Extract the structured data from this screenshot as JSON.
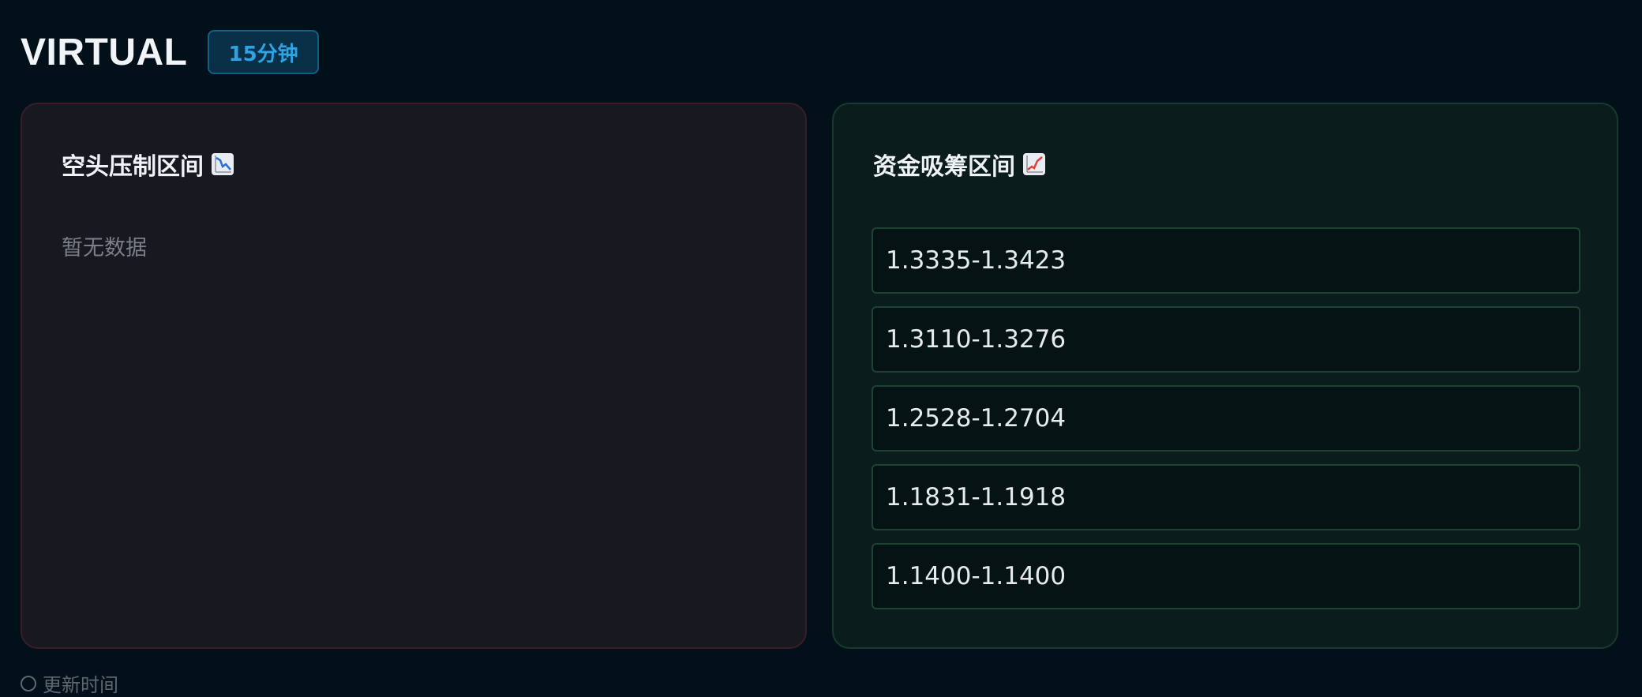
{
  "header": {
    "symbol": "VIRTUAL",
    "timeframe": "15分钟"
  },
  "panels": {
    "resistance": {
      "title": "空头压制区间",
      "icon": "chart-decreasing-icon",
      "empty_text": "暂无数据"
    },
    "support": {
      "title": "资金吸筹区间",
      "icon": "chart-increasing-icon",
      "zones": [
        "1.3335-1.3423",
        "1.3110-1.3276",
        "1.2528-1.2704",
        "1.1831-1.1918",
        "1.1400-1.1400"
      ]
    }
  },
  "footer": {
    "label": "更新时间"
  },
  "colors": {
    "background": "#02101a",
    "accent": "#2ca4e4",
    "bear_border": "#3b1c24",
    "bull_border": "#173a2e",
    "chart_down": "#2a6fd6",
    "chart_up": "#e0403a"
  }
}
